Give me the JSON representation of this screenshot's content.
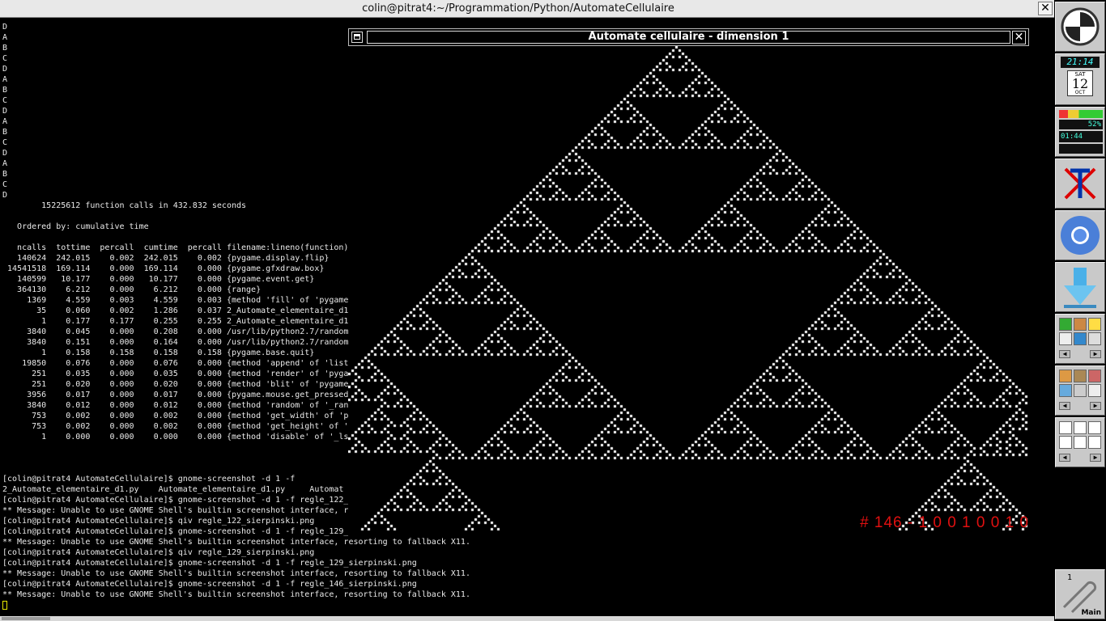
{
  "terminal_window": {
    "title": "colin@pitrat4:~/Programmation/Python/AutomateCellulaire",
    "close_glyph": "✕",
    "lines": [
      "D",
      "A",
      "B",
      "C",
      "D",
      "A",
      "B",
      "C",
      "D",
      "A",
      "B",
      "C",
      "D",
      "A",
      "B",
      "C",
      "D",
      "        15225612 function calls in 432.832 seconds",
      "",
      "   Ordered by: cumulative time",
      "",
      "   ncalls  tottime  percall  cumtime  percall filename:lineno(function)",
      "   140624  242.015    0.002  242.015    0.002 {pygame.display.flip}",
      " 14541518  169.114    0.000  169.114    0.000 {pygame.gfxdraw.box}",
      "   140599   10.177    0.000   10.177    0.000 {pygame.event.get}",
      "   364130    6.212    0.000    6.212    0.000 {range}",
      "     1369    4.559    0.003    4.559    0.003 {method 'fill' of 'pygame",
      "       35    0.060    0.002    1.286    0.037 2_Automate_elementaire_d1",
      "        1    0.177    0.177    0.255    0.255 2_Automate_elementaire_d1",
      "     3840    0.045    0.000    0.208    0.000 /usr/lib/python2.7/random",
      "     3840    0.151    0.000    0.164    0.000 /usr/lib/python2.7/random",
      "        1    0.158    0.158    0.158    0.158 {pygame.base.quit}",
      "    19850    0.076    0.000    0.076    0.000 {method 'append' of 'list",
      "      251    0.035    0.000    0.035    0.000 {method 'render' of 'pyga",
      "      251    0.020    0.000    0.020    0.000 {method 'blit' of 'pygame",
      "     3956    0.017    0.000    0.017    0.000 {pygame.mouse.get_pressed",
      "     3840    0.012    0.000    0.012    0.000 {method 'random' of '_ran",
      "      753    0.002    0.000    0.002    0.000 {method 'get_width' of 'p",
      "      753    0.002    0.000    0.002    0.000 {method 'get_height' of '",
      "        1    0.000    0.000    0.000    0.000 {method 'disable' of '_ls",
      "",
      "",
      "",
      "[colin@pitrat4 AutomateCellulaire]$ gnome-screenshot -d 1 -f",
      "2_Automate_elementaire_d1.py    Automate_elementaire_d1.py     Automat",
      "[colin@pitrat4 AutomateCellulaire]$ gnome-screenshot -d 1 -f regle_122_",
      "** Message: Unable to use GNOME Shell's builtin screenshot interface, re",
      "[colin@pitrat4 AutomateCellulaire]$ qiv regle_122_sierpinski.png",
      "[colin@pitrat4 AutomateCellulaire]$ gnome-screenshot -d 1 -f regle_129_",
      "** Message: Unable to use GNOME Shell's builtin screenshot interface, resorting to fallback X11.",
      "[colin@pitrat4 AutomateCellulaire]$ qiv regle_129_sierpinski.png",
      "[colin@pitrat4 AutomateCellulaire]$ gnome-screenshot -d 1 -f regle_129_sierpinski.png",
      "** Message: Unable to use GNOME Shell's builtin screenshot interface, resorting to fallback X11.",
      "[colin@pitrat4 AutomateCellulaire]$ gnome-screenshot -d 1 -f regle_146_sierpinski.png",
      "** Message: Unable to use GNOME Shell's builtin screenshot interface, resorting to fallback X11."
    ]
  },
  "automaton_window": {
    "title": "Automate cellulaire - dimension 1",
    "close_glyph": "✕",
    "rule_number": 146,
    "rule_label": "# 146 - 1 0 0 1 0 0 1 0",
    "cell_color": "#ffffff",
    "background_color": "#000000",
    "label_color": "#e01010"
  },
  "dock": {
    "clock_time": "21:14",
    "calendar": {
      "weekday": "SAT",
      "day": "12",
      "month": "OCT"
    },
    "battery": "52%",
    "uptime": "01:44",
    "workspace": {
      "number": "1",
      "name": "Main"
    },
    "apps": [
      "dock-logo-icon",
      "xfig-icon",
      "chromium-icon",
      "download-icon"
    ]
  }
}
